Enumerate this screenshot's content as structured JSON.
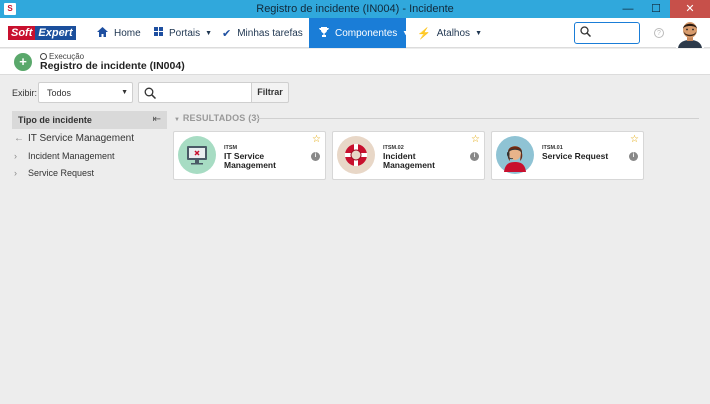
{
  "window": {
    "app_icon": "S",
    "title": "Registro de incidente (IN004) - Incidente",
    "minimize": "—",
    "maximize": "☐",
    "close": "✕"
  },
  "logo": {
    "part1": "Soft",
    "part2": "Expert"
  },
  "nav": {
    "items": [
      {
        "label": "Home",
        "icon": "home-icon"
      },
      {
        "label": "Portais",
        "icon": "grid-icon"
      },
      {
        "label": "Minhas tarefas",
        "icon": "check-icon"
      },
      {
        "label": "Componentes",
        "icon": "trophy-icon"
      },
      {
        "label": "Atalhos",
        "icon": "bolt-icon"
      }
    ],
    "active": "Componentes"
  },
  "page": {
    "breadcrumb": "Execução",
    "title": "Registro de incidente (IN004)"
  },
  "filter": {
    "show_label": "Exibir:",
    "show_value": "Todos",
    "query_value": "",
    "filter_button": "Filtrar"
  },
  "panel": {
    "title": "Tipo de incidente",
    "root": "IT Service Management",
    "children": [
      "Incident Management",
      "Service Request"
    ]
  },
  "results": {
    "header": "RESULTADOS (3)",
    "cards": [
      {
        "code": "ITSM",
        "name": "IT Service Management",
        "icon": "monitor-icon",
        "icon_bg": "#a7dcc3"
      },
      {
        "code": "ITSM.02",
        "name": "Incident Management",
        "icon": "lifebuoy-icon",
        "icon_bg": "#e8d7c7"
      },
      {
        "code": "ITSM.01",
        "name": "Service Request",
        "icon": "support-agent-icon",
        "icon_bg": "#8fc3d4"
      }
    ]
  },
  "colors": {
    "titlebar": "#30a8dc",
    "accent": "#1a7dd7",
    "close_button": "#c7504a",
    "brand_red": "#c8102e",
    "brand_blue": "#1b4f9c",
    "star": "#e0a400"
  }
}
